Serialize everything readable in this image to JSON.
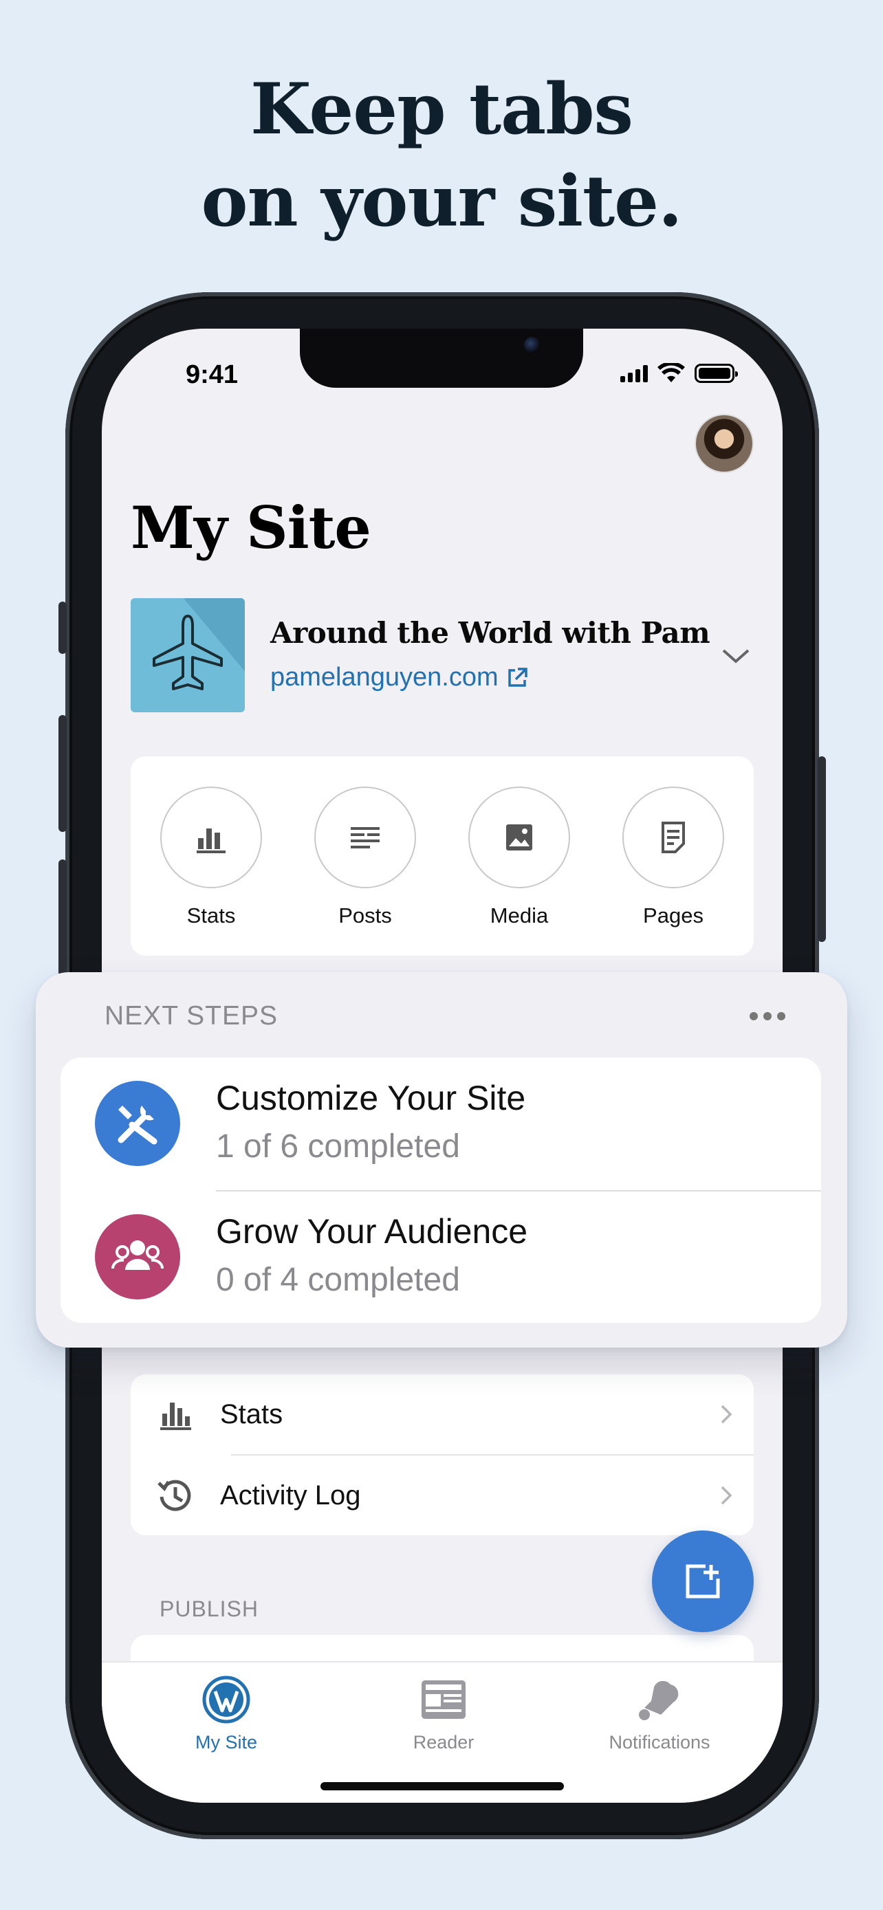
{
  "headline": {
    "line1": "Keep tabs",
    "line2": "on your site."
  },
  "status_bar": {
    "time": "9:41"
  },
  "page": {
    "title": "My Site"
  },
  "site": {
    "name": "Around the World with Pam",
    "url": "pamelanguyen.com"
  },
  "quick_actions": [
    {
      "label": "Stats",
      "icon": "bar-chart-icon"
    },
    {
      "label": "Posts",
      "icon": "posts-icon"
    },
    {
      "label": "Media",
      "icon": "image-icon"
    },
    {
      "label": "Pages",
      "icon": "page-icon"
    }
  ],
  "next_steps": {
    "title": "NEXT STEPS",
    "items": [
      {
        "title": "Customize Your Site",
        "progress": "1 of 6 completed",
        "color": "#3a7bd4",
        "icon": "tools-icon"
      },
      {
        "title": "Grow Your Audience",
        "progress": "0 of 4 completed",
        "color": "#b8426f",
        "icon": "people-icon"
      }
    ]
  },
  "menu": [
    {
      "label": "Stats",
      "icon": "bar-chart-icon"
    },
    {
      "label": "Activity Log",
      "icon": "history-icon"
    }
  ],
  "publish_section": {
    "label": "PUBLISH"
  },
  "tabs": [
    {
      "label": "My Site",
      "active": true,
      "icon": "wordpress-icon"
    },
    {
      "label": "Reader",
      "active": false,
      "icon": "reader-icon"
    },
    {
      "label": "Notifications",
      "active": false,
      "icon": "bell-icon"
    }
  ],
  "colors": {
    "accent": "#2271b1",
    "fab": "#3a7bd4",
    "inactive": "#8a8a8e",
    "background": "#e3edf8"
  }
}
